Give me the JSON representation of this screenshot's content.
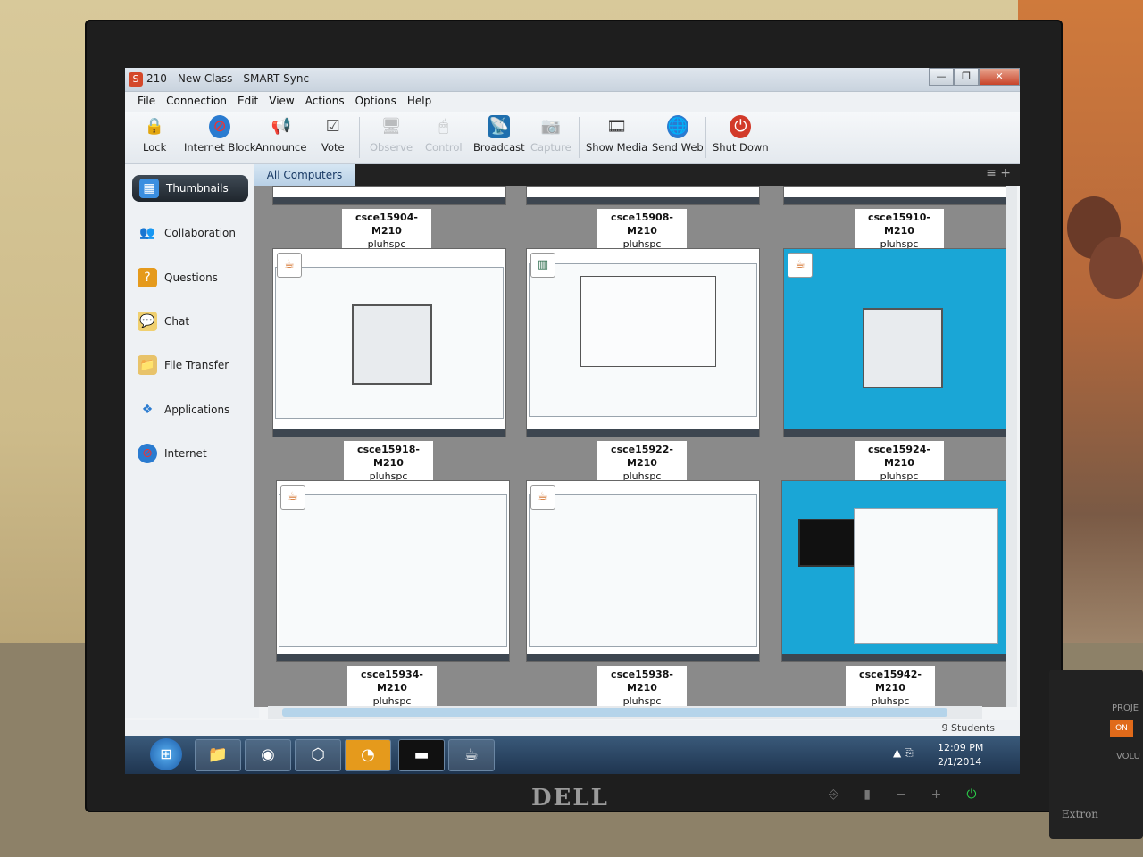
{
  "window": {
    "title": "210 - New Class - SMART Sync",
    "app_icon": "S",
    "buttons": [
      "—",
      "❐",
      "✕"
    ]
  },
  "menu": [
    "File",
    "Connection",
    "Edit",
    "View",
    "Actions",
    "Options",
    "Help"
  ],
  "toolbar": {
    "lock": "Lock",
    "internet_block": "Internet Block",
    "announce": "Announce",
    "vote": "Vote",
    "observe": "Observe",
    "control": "Control",
    "broadcast": "Broadcast",
    "capture": "Capture",
    "show_media": "Show Media",
    "send_web": "Send Web",
    "shut_down": "Shut Down"
  },
  "sidebar": {
    "items": [
      {
        "label": "Thumbnails",
        "icon": "thumbnails-icon"
      },
      {
        "label": "Collaboration",
        "icon": "people-icon"
      },
      {
        "label": "Questions",
        "icon": "question-icon"
      },
      {
        "label": "Chat",
        "icon": "chat-icon"
      },
      {
        "label": "File Transfer",
        "icon": "folder-icon"
      },
      {
        "label": "Applications",
        "icon": "applications-icon"
      },
      {
        "label": "Internet",
        "icon": "globe-icon"
      }
    ]
  },
  "tabs": {
    "active": "All Computers",
    "tools": "≡ +"
  },
  "computers": [
    {
      "name": "csce15904-M210",
      "user": "pluhspc"
    },
    {
      "name": "csce15908-M210",
      "user": "pluhspc"
    },
    {
      "name": "csce15910-M210",
      "user": "pluhspc"
    },
    {
      "name": "csce15918-M210",
      "user": "pluhspc"
    },
    {
      "name": "csce15922-M210",
      "user": "pluhspc"
    },
    {
      "name": "csce15924-M210",
      "user": "pluhspc"
    },
    {
      "name": "csce15934-M210",
      "user": "pluhspc"
    },
    {
      "name": "csce15938-M210",
      "user": "pluhspc"
    },
    {
      "name": "csce15942-M210",
      "user": "pluhspc"
    }
  ],
  "status": {
    "students": "9 Students"
  },
  "taskbar": {
    "time": "12:09 PM",
    "date": "2/1/2014"
  },
  "bezel": {
    "brand": "DELL"
  },
  "extron": {
    "on": "ON",
    "proj": "PROJE",
    "volume": "VOLU",
    "brand": "Extron"
  }
}
